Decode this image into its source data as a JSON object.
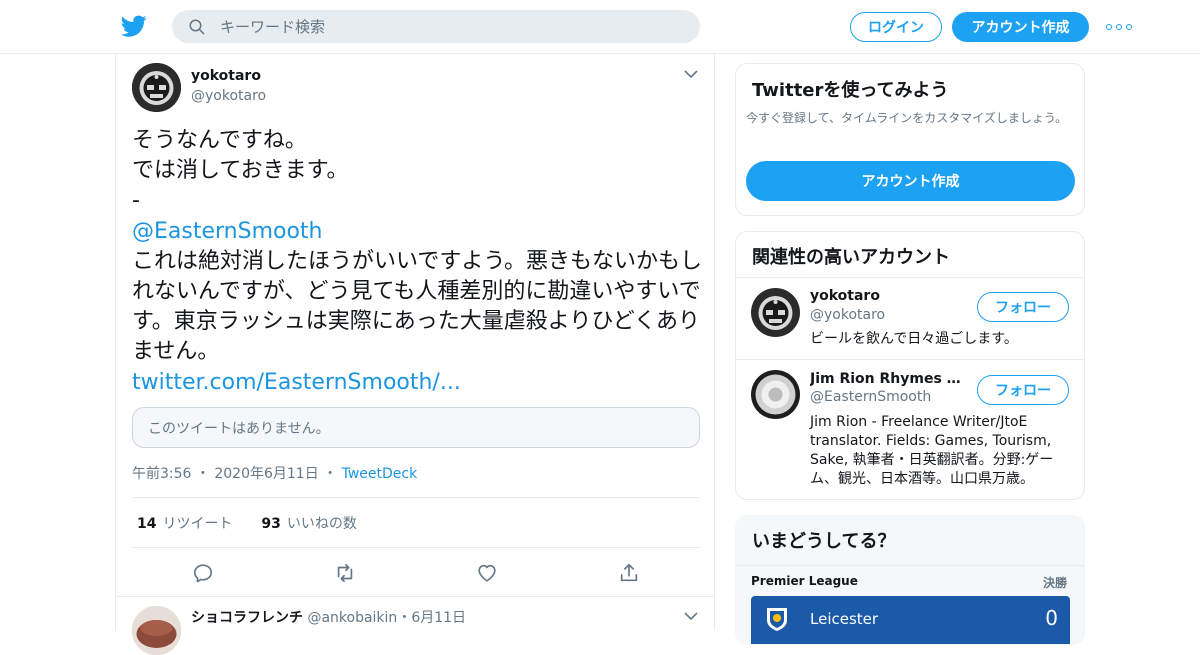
{
  "header": {
    "search_placeholder": "キーワード検索",
    "login_label": "ログイン",
    "signup_label": "アカウント作成"
  },
  "tweet": {
    "author_name": "yokotaro",
    "author_handle": "@yokotaro",
    "text_line1": "そうなんですね。",
    "text_line2": "では消しておきます。",
    "text_line3": "-",
    "mention": "@EasternSmooth",
    "quoted_text": "これは絶対消したほうがいいですよう。悪きもないかもしれないんですが、どう見ても人種差別的に勘違いやすいです。東京ラッシュは実際にあった大量虐殺よりひどくありません。",
    "link": "twitter.com/EasternSmooth/...",
    "unavailable_quote": "このツイートはありません。",
    "time": "午前3:56",
    "date": "2020年6月11日",
    "source": "TweetDeck",
    "retweet_count": "14",
    "retweet_label": "リツイート",
    "like_count": "93",
    "like_label": "いいねの数"
  },
  "next_tweet": {
    "author_name": "ショコラフレンチ",
    "author_handle": "@ankobaikin",
    "date": "6月11日"
  },
  "signup_card": {
    "title": "Twitterを使ってみよう",
    "description": "今すぐ登録して、タイムラインをカスタマイズしましょう。",
    "button": "アカウント作成"
  },
  "related": {
    "title": "関連性の高いアカウント",
    "follow_label": "フォロー",
    "accounts": [
      {
        "name": "yokotaro",
        "handle": "@yokotaro",
        "bio": "ビールを飲んで日々過ごします。"
      },
      {
        "name": "Jim Rion Rhymes wit...",
        "handle": "@EasternSmooth",
        "bio": "Jim Rion - Freelance Writer/JtoE translator. Fields: Games, Tourism, Sake, 執筆者・日英翻訳者。分野:ゲーム、観光、日本酒等。山口県万歳。"
      }
    ]
  },
  "trends": {
    "title": "いまどうしてる？",
    "league": "Premier League",
    "status": "決勝",
    "team": "Leicester",
    "score": "0"
  },
  "colors": {
    "accent": "#1da1f2",
    "link": "#1b95e0",
    "muted": "#657786"
  }
}
